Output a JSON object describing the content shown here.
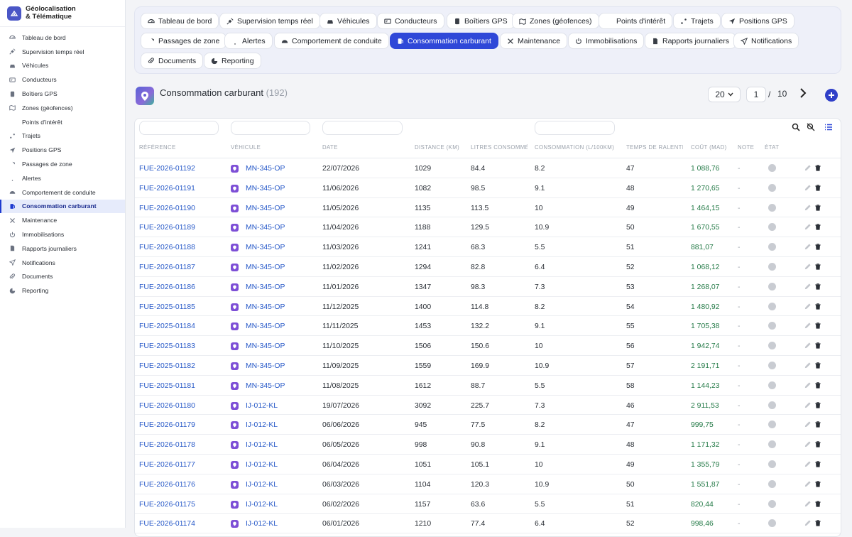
{
  "app": {
    "title_line1": "Géolocalisation",
    "title_line2": "& Télématique"
  },
  "sidebar": {
    "items": [
      {
        "label": "Tableau de bord",
        "icon": "dashboard-icon"
      },
      {
        "label": "Supervision temps réel",
        "icon": "satellite-icon"
      },
      {
        "label": "Véhicules",
        "icon": "car-icon"
      },
      {
        "label": "Conducteurs",
        "icon": "id-card-icon"
      },
      {
        "label": "Boîtiers GPS",
        "icon": "device-icon"
      },
      {
        "label": "Zones (géofences)",
        "icon": "map-icon"
      },
      {
        "label": "Points d'intérêt",
        "icon": "pin-icon"
      },
      {
        "label": "Trajets",
        "icon": "route-icon"
      },
      {
        "label": "Positions GPS",
        "icon": "location-arrow-icon"
      },
      {
        "label": "Passages de zone",
        "icon": "shield-icon"
      },
      {
        "label": "Alertes",
        "icon": "bell-icon"
      },
      {
        "label": "Comportement de conduite",
        "icon": "gauge-icon"
      },
      {
        "label": "Consommation carburant",
        "icon": "fuel-icon",
        "active": true
      },
      {
        "label": "Maintenance",
        "icon": "tools-icon"
      },
      {
        "label": "Immobilisations",
        "icon": "power-icon"
      },
      {
        "label": "Rapports journaliers",
        "icon": "report-icon"
      },
      {
        "label": "Notifications",
        "icon": "send-icon"
      },
      {
        "label": "Documents",
        "icon": "paperclip-icon"
      },
      {
        "label": "Reporting",
        "icon": "pie-chart-icon"
      }
    ]
  },
  "tabs": [
    {
      "label": "Tableau de bord",
      "icon": "dashboard-icon"
    },
    {
      "label": "Supervision temps réel",
      "icon": "satellite-icon"
    },
    {
      "label": "Véhicules",
      "icon": "car-icon"
    },
    {
      "label": "Conducteurs",
      "icon": "id-card-icon"
    },
    {
      "label": "Boîtiers GPS",
      "icon": "device-icon"
    },
    {
      "label": "Zones (géofences)",
      "icon": "map-icon"
    },
    {
      "label": "Points d'intérêt",
      "icon": "pin-icon"
    },
    {
      "label": "Trajets",
      "icon": "route-icon"
    },
    {
      "label": "Positions GPS",
      "icon": "location-arrow-icon"
    },
    {
      "label": "Passages de zone",
      "icon": "shield-icon"
    },
    {
      "label": "Alertes",
      "icon": "bell-icon"
    },
    {
      "label": "Comportement de conduite",
      "icon": "gauge-icon"
    },
    {
      "label": "Consommation carburant",
      "icon": "fuel-icon",
      "active": true
    },
    {
      "label": "Maintenance",
      "icon": "tools-icon"
    },
    {
      "label": "Immobilisations",
      "icon": "power-icon"
    },
    {
      "label": "Rapports journaliers",
      "icon": "report-icon"
    },
    {
      "label": "Notifications",
      "icon": "send-icon"
    },
    {
      "label": "Documents",
      "icon": "paperclip-icon"
    },
    {
      "label": "Reporting",
      "icon": "pie-chart-icon"
    }
  ],
  "page": {
    "title": "Consommation carburant",
    "count": "(192)"
  },
  "pagination": {
    "per_page": "20",
    "current": "1",
    "separator": "/",
    "total": "10"
  },
  "table": {
    "columns": {
      "reference": "RÉFÉRENCE",
      "vehicule": "VÉHICULE",
      "date": "DATE",
      "distance": "DISTANCE (KM)",
      "litres": "LITRES CONSOMMÉS",
      "consommation": "CONSOMMATION (L/100KM)",
      "ralenti": "TEMPS DE RALENTI",
      "cout": "COÛT (MAD)",
      "note": "NOTE",
      "etat": "ÉTAT"
    },
    "rows": [
      {
        "ref": "FUE-2026-01192",
        "veh": "MN-345-OP",
        "date": "22/07/2026",
        "dist": "1029",
        "lit": "84.4",
        "cons": "8.2",
        "ral": "47",
        "cout": "1 088,76",
        "note": "-"
      },
      {
        "ref": "FUE-2026-01191",
        "veh": "MN-345-OP",
        "date": "11/06/2026",
        "dist": "1082",
        "lit": "98.5",
        "cons": "9.1",
        "ral": "48",
        "cout": "1 270,65",
        "note": "-"
      },
      {
        "ref": "FUE-2026-01190",
        "veh": "MN-345-OP",
        "date": "11/05/2026",
        "dist": "1135",
        "lit": "113.5",
        "cons": "10",
        "ral": "49",
        "cout": "1 464,15",
        "note": "-"
      },
      {
        "ref": "FUE-2026-01189",
        "veh": "MN-345-OP",
        "date": "11/04/2026",
        "dist": "1188",
        "lit": "129.5",
        "cons": "10.9",
        "ral": "50",
        "cout": "1 670,55",
        "note": "-"
      },
      {
        "ref": "FUE-2026-01188",
        "veh": "MN-345-OP",
        "date": "11/03/2026",
        "dist": "1241",
        "lit": "68.3",
        "cons": "5.5",
        "ral": "51",
        "cout": "881,07",
        "note": "-"
      },
      {
        "ref": "FUE-2026-01187",
        "veh": "MN-345-OP",
        "date": "11/02/2026",
        "dist": "1294",
        "lit": "82.8",
        "cons": "6.4",
        "ral": "52",
        "cout": "1 068,12",
        "note": "-"
      },
      {
        "ref": "FUE-2026-01186",
        "veh": "MN-345-OP",
        "date": "11/01/2026",
        "dist": "1347",
        "lit": "98.3",
        "cons": "7.3",
        "ral": "53",
        "cout": "1 268,07",
        "note": "-"
      },
      {
        "ref": "FUE-2025-01185",
        "veh": "MN-345-OP",
        "date": "11/12/2025",
        "dist": "1400",
        "lit": "114.8",
        "cons": "8.2",
        "ral": "54",
        "cout": "1 480,92",
        "note": "-"
      },
      {
        "ref": "FUE-2025-01184",
        "veh": "MN-345-OP",
        "date": "11/11/2025",
        "dist": "1453",
        "lit": "132.2",
        "cons": "9.1",
        "ral": "55",
        "cout": "1 705,38",
        "note": "-"
      },
      {
        "ref": "FUE-2025-01183",
        "veh": "MN-345-OP",
        "date": "11/10/2025",
        "dist": "1506",
        "lit": "150.6",
        "cons": "10",
        "ral": "56",
        "cout": "1 942,74",
        "note": "-"
      },
      {
        "ref": "FUE-2025-01182",
        "veh": "MN-345-OP",
        "date": "11/09/2025",
        "dist": "1559",
        "lit": "169.9",
        "cons": "10.9",
        "ral": "57",
        "cout": "2 191,71",
        "note": "-"
      },
      {
        "ref": "FUE-2025-01181",
        "veh": "MN-345-OP",
        "date": "11/08/2025",
        "dist": "1612",
        "lit": "88.7",
        "cons": "5.5",
        "ral": "58",
        "cout": "1 144,23",
        "note": "-"
      },
      {
        "ref": "FUE-2026-01180",
        "veh": "IJ-012-KL",
        "date": "19/07/2026",
        "dist": "3092",
        "lit": "225.7",
        "cons": "7.3",
        "ral": "46",
        "cout": "2 911,53",
        "note": "-"
      },
      {
        "ref": "FUE-2026-01179",
        "veh": "IJ-012-KL",
        "date": "06/06/2026",
        "dist": "945",
        "lit": "77.5",
        "cons": "8.2",
        "ral": "47",
        "cout": "999,75",
        "note": "-"
      },
      {
        "ref": "FUE-2026-01178",
        "veh": "IJ-012-KL",
        "date": "06/05/2026",
        "dist": "998",
        "lit": "90.8",
        "cons": "9.1",
        "ral": "48",
        "cout": "1 171,32",
        "note": "-"
      },
      {
        "ref": "FUE-2026-01177",
        "veh": "IJ-012-KL",
        "date": "06/04/2026",
        "dist": "1051",
        "lit": "105.1",
        "cons": "10",
        "ral": "49",
        "cout": "1 355,79",
        "note": "-"
      },
      {
        "ref": "FUE-2026-01176",
        "veh": "IJ-012-KL",
        "date": "06/03/2026",
        "dist": "1104",
        "lit": "120.3",
        "cons": "10.9",
        "ral": "50",
        "cout": "1 551,87",
        "note": "-"
      },
      {
        "ref": "FUE-2026-01175",
        "veh": "IJ-012-KL",
        "date": "06/02/2026",
        "dist": "1157",
        "lit": "63.6",
        "cons": "5.5",
        "ral": "51",
        "cout": "820,44",
        "note": "-"
      },
      {
        "ref": "FUE-2026-01174",
        "veh": "IJ-012-KL",
        "date": "06/01/2026",
        "dist": "1210",
        "lit": "77.4",
        "cons": "6.4",
        "ral": "52",
        "cout": "998,46",
        "note": "-"
      }
    ]
  }
}
